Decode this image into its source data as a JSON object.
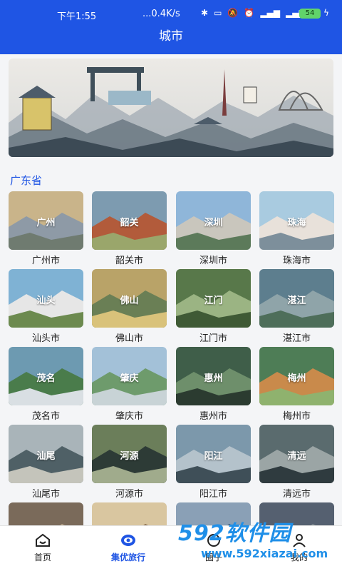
{
  "status_bar": {
    "time": "下午1:55",
    "network_speed": "...0.4K/s",
    "battery": "54"
  },
  "app_bar": {
    "title": "城市"
  },
  "banner": {
    "name": "guangdong-landmark-painting"
  },
  "section": {
    "title": "广东省"
  },
  "cities": [
    {
      "tile_label": "广州",
      "caption": "广州市"
    },
    {
      "tile_label": "韶关",
      "caption": "韶关市"
    },
    {
      "tile_label": "深圳",
      "caption": "深圳市"
    },
    {
      "tile_label": "珠海",
      "caption": "珠海市"
    },
    {
      "tile_label": "汕头",
      "caption": "汕头市"
    },
    {
      "tile_label": "佛山",
      "caption": "佛山市"
    },
    {
      "tile_label": "江门",
      "caption": "江门市"
    },
    {
      "tile_label": "湛江",
      "caption": "湛江市"
    },
    {
      "tile_label": "茂名",
      "caption": "茂名市"
    },
    {
      "tile_label": "肇庆",
      "caption": "肇庆市"
    },
    {
      "tile_label": "惠州",
      "caption": "惠州市"
    },
    {
      "tile_label": "梅州",
      "caption": "梅州市"
    },
    {
      "tile_label": "汕尾",
      "caption": "汕尾市"
    },
    {
      "tile_label": "河源",
      "caption": "河源市"
    },
    {
      "tile_label": "阳江",
      "caption": "阳江市"
    },
    {
      "tile_label": "清远",
      "caption": "清远市"
    },
    {
      "tile_label": "",
      "caption": ""
    },
    {
      "tile_label": "",
      "caption": ""
    },
    {
      "tile_label": "",
      "caption": ""
    },
    {
      "tile_label": "",
      "caption": ""
    }
  ],
  "tabs": [
    {
      "label": "首页",
      "icon": "home-icon"
    },
    {
      "label": "集优旅行",
      "icon": "eye-icon"
    },
    {
      "label": "圈子",
      "icon": "circle-icon"
    },
    {
      "label": "我的",
      "icon": "user-icon"
    }
  ],
  "watermark": {
    "brand": "592软件园",
    "url": "www.592xiazai.com"
  },
  "colors": {
    "primary": "#1f55e4",
    "background": "#f4f5f7"
  }
}
